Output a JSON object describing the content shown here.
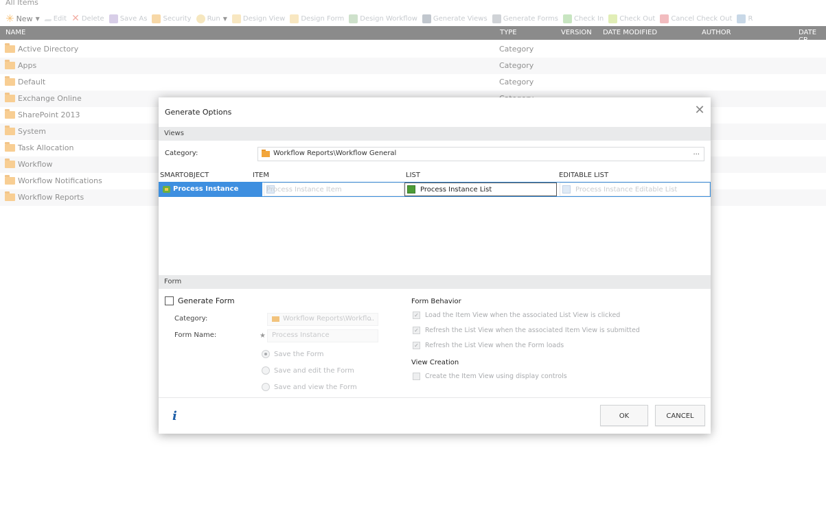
{
  "page": {
    "breadcrumb": "All Items"
  },
  "toolbar": {
    "new_label": "New",
    "items": [
      {
        "label": "Edit",
        "icon": "pencil-icon"
      },
      {
        "label": "Delete",
        "icon": "delete-x-icon"
      },
      {
        "label": "Save As",
        "icon": "save-as-icon"
      },
      {
        "label": "Security",
        "icon": "lock-icon"
      },
      {
        "label": "Run",
        "icon": "run-icon"
      },
      {
        "label": "Design View",
        "icon": "design-view-icon"
      },
      {
        "label": "Design Form",
        "icon": "design-form-icon"
      },
      {
        "label": "Design Workflow",
        "icon": "design-workflow-icon"
      },
      {
        "label": "Generate Views",
        "icon": "generate-views-icon"
      },
      {
        "label": "Generate Forms",
        "icon": "generate-forms-icon"
      },
      {
        "label": "Check In",
        "icon": "check-in-icon"
      },
      {
        "label": "Check Out",
        "icon": "check-out-icon"
      },
      {
        "label": "Cancel Check Out",
        "icon": "cancel-check-out-icon"
      },
      {
        "label": "R",
        "icon": "refresh-icon"
      }
    ]
  },
  "grid": {
    "columns": [
      "NAME",
      "TYPE",
      "VERSION",
      "DATE MODIFIED",
      "AUTHOR",
      "DATE CR"
    ],
    "rows": [
      {
        "name": "Active Directory",
        "type": "Category"
      },
      {
        "name": "Apps",
        "type": "Category"
      },
      {
        "name": "Default",
        "type": "Category"
      },
      {
        "name": "Exchange Online",
        "type": "Category"
      },
      {
        "name": "SharePoint 2013",
        "type": ""
      },
      {
        "name": "System",
        "type": ""
      },
      {
        "name": "Task Allocation",
        "type": ""
      },
      {
        "name": "Workflow",
        "type": ""
      },
      {
        "name": "Workflow Notifications",
        "type": ""
      },
      {
        "name": "Workflow Reports",
        "type": ""
      }
    ]
  },
  "dialog": {
    "title": "Generate Options",
    "views_section": "Views",
    "category_label": "Category:",
    "category_value": "Workflow Reports\\Workflow General",
    "browse_label": "...",
    "views_columns": [
      "SMARTOBJECT",
      "ITEM",
      "LIST",
      "EDITABLE LIST"
    ],
    "views_row": {
      "smartobject": "Process Instance",
      "item_placeholder": "Process Instance Item",
      "list_value": "Process Instance List",
      "editable_list_placeholder": "Process Instance Editable List"
    },
    "form_section": "Form",
    "generate_form_label": "Generate Form",
    "form_category_label": "Category:",
    "form_category_value": "Workflow Reports\\Workflo",
    "form_category_browse": "...",
    "form_name_label": "Form Name:",
    "form_name_value": "Process Instance",
    "radios": [
      "Save the Form",
      "Save and edit the Form",
      "Save and view the Form"
    ],
    "behavior_heading": "Form Behavior",
    "behavior_options": [
      "Load the Item View when the associated List View is clicked",
      "Refresh the List View when the associated Item View is submitted",
      "Refresh the List View when the Form loads"
    ],
    "view_creation_heading": "View Creation",
    "view_creation_option": "Create the Item View using display controls",
    "ok_label": "OK",
    "cancel_label": "CANCEL",
    "info_glyph": "i"
  }
}
